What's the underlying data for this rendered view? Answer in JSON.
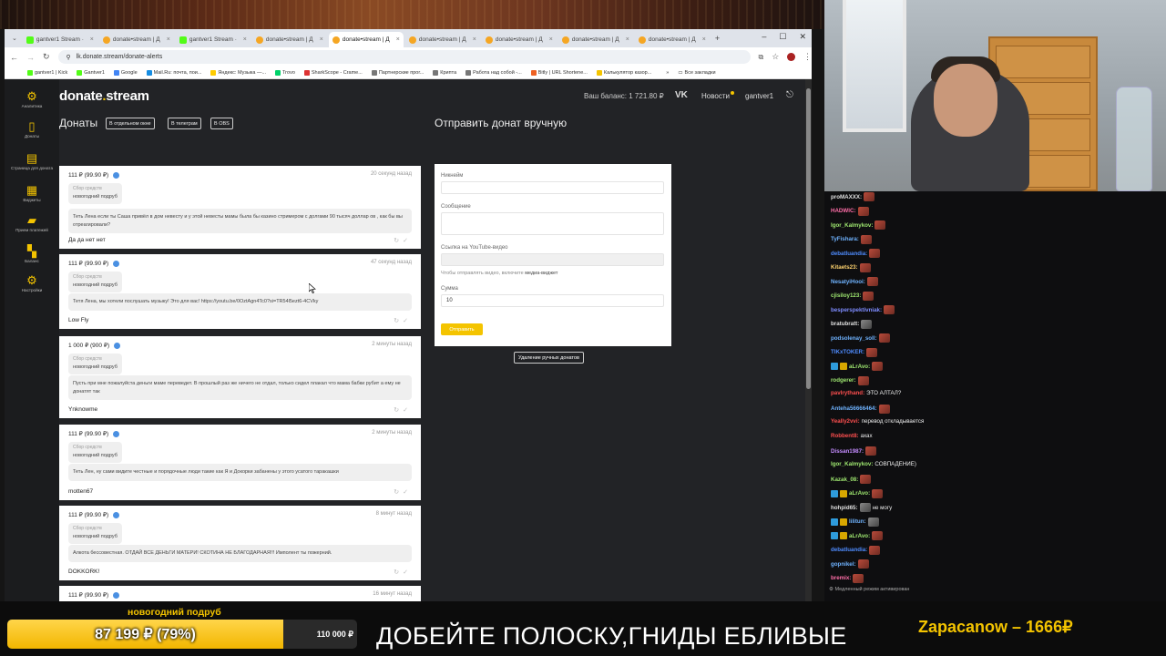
{
  "browser": {
    "tabs": [
      {
        "label": "gantver1 Stream ·",
        "fav": "k"
      },
      {
        "label": "donate•stream | Д",
        "fav": "d"
      },
      {
        "label": "gantver1 Stream ·",
        "fav": "k"
      },
      {
        "label": "donate•stream | Д",
        "fav": "d"
      },
      {
        "label": "donate•stream | Д",
        "fav": "d",
        "active": true
      },
      {
        "label": "donate•stream | Д",
        "fav": "d"
      },
      {
        "label": "donate•stream | Д",
        "fav": "d"
      },
      {
        "label": "donate•stream | Д",
        "fav": "d"
      },
      {
        "label": "donate•stream | Д",
        "fav": "d"
      }
    ],
    "new_tab": "+",
    "url": "lk.donate.stream/donate-alerts",
    "bookmarks": [
      "gantver1 | Kick",
      "Gantver1",
      "Google",
      "Mail.Ru: почта, пои...",
      "Яндекс: Музыка —...",
      "Trovo",
      "SharkScope - Crame...",
      "Партнерские прог...",
      "Крипта",
      "Работа над собой -...",
      "Bitly | URL Shortene...",
      "Калькулятор казор..."
    ],
    "all_bookmarks": "Все закладки"
  },
  "site": {
    "logo_a": "donate",
    "logo_dot": ".",
    "logo_b": "stream",
    "balance": "Ваш баланс: 1 721.80 ₽",
    "vk": "VK",
    "news": "Новости",
    "user": "gantver1",
    "nav": [
      {
        "label": "Аналитика",
        "icon": "chart-icon",
        "glyph": "⚙"
      },
      {
        "label": "Донаты",
        "icon": "phone-icon",
        "glyph": "▯"
      },
      {
        "label": "Страница для доната",
        "icon": "page-icon",
        "glyph": "▤"
      },
      {
        "label": "Виджеты",
        "icon": "widgets-icon",
        "glyph": "▦"
      },
      {
        "label": "Прием платежей",
        "icon": "payments-icon",
        "glyph": "▰"
      },
      {
        "label": "Баланс",
        "icon": "balance-icon",
        "glyph": "▚"
      },
      {
        "label": "Настройки",
        "icon": "settings-icon",
        "glyph": "⚙"
      }
    ],
    "donates_title": "Донаты",
    "pills": [
      "В отдельном окне",
      "В телеграм",
      "В OBS"
    ],
    "manual_title": "Отправить донат вручную"
  },
  "donations": [
    {
      "amount": "111 ₽ (99.90 ₽)",
      "time": "20 секунд назад",
      "goal_label": "Сбор средств",
      "goal": "новогодний подруб",
      "message": "Теть Лена если ты Саша привёл в дом невесту и у этой невесты мамы была бы казино стримером с долгами 90 тысяч доллар ов , как бы вы отреагировали?",
      "sender": "Да да нет нет"
    },
    {
      "amount": "111 ₽ (99.90 ₽)",
      "time": "47 секунд назад",
      "goal_label": "Сбор средств",
      "goal": "новогодний подруб",
      "message": "Тетя Лена, мы хотели послушать музыку! Это для вас! https://youtu.be/0OztAgn4Tc0?si=TR54l5ezt6-4CVky",
      "sender": "Low Fly"
    },
    {
      "amount": "1 000 ₽ (900 ₽)",
      "time": "2 минуты назад",
      "goal_label": "Сбор средств",
      "goal": "новогодний подруб",
      "message": "Пусть при мне пожалуйста деньги маме переведет. В прошлый раз же ничего не отдал, только сидел плакал что мама бабки рубит а ему не донатят так",
      "sender": "Ynknowme"
    },
    {
      "amount": "111 ₽ (99.90 ₽)",
      "time": "2 минуты назад",
      "goal_label": "Сбор средств",
      "goal": "новогодний подруб",
      "message": "Теть Лен, ну сами видите честные и порядочные люди такие как Я и Докорки забанены у этого усатого таракашки",
      "sender": "motten67"
    },
    {
      "amount": "111 ₽ (99.90 ₽)",
      "time": "8 минут назад",
      "goal_label": "Сбор средств",
      "goal": "новогодний подруб",
      "message": "Алкота бессовестная. ОТДАЙ ВСЕ ДЕНЬГИ МАТЕРИ! СКОТИНА НЕ БЛАГОДАРНАЯ!!! Имполент ты пожерний.",
      "sender": "DOKKORK!"
    },
    {
      "amount": "111 ₽ (99.90 ₽)",
      "time": "16 минут назад",
      "goal_label": "Сбор средств",
      "goal": "новогодний подруб",
      "message": "",
      "sender": ""
    }
  ],
  "form": {
    "nickname_label": "Никнейм",
    "message_label": "Сообщение",
    "youtube_label": "Ссылка на YouTube-видео",
    "youtube_hint": "Чтобы отправлять видео, включите",
    "youtube_hint_link": "медиа-виджет",
    "sum_label": "Сумма",
    "sum_value": "10",
    "send_button": "Отправить",
    "delete_button": "Удаление ручных донатов"
  },
  "chat": {
    "lines": [
      {
        "user": "proMAXXX:",
        "color": "#e0e0e0",
        "text": "",
        "emote": true
      },
      {
        "user": "HADWIC:",
        "color": "#ff6ea8",
        "text": "",
        "emote": true
      },
      {
        "user": "Igor_Kalmykov:",
        "color": "#9fe870",
        "text": "",
        "emote": true
      },
      {
        "user": "TyFishara:",
        "color": "#6fb3ff",
        "text": "",
        "emote": true
      },
      {
        "user": "debatluandia:",
        "color": "#4f8cff",
        "text": "",
        "emote": true
      },
      {
        "user": "Kitaets23:",
        "color": "#ffd36e",
        "text": "",
        "emote": true
      },
      {
        "user": "NesatyiHooi:",
        "color": "#6fb3ff",
        "text": "",
        "emote": true
      },
      {
        "user": "cjisiloy123:",
        "color": "#9fe870",
        "text": "",
        "emote": true
      },
      {
        "user": "besperspektivniak:",
        "color": "#7e8cff",
        "text": "",
        "emote": true
      },
      {
        "user": "bratubratt:",
        "color": "#e0e0e0",
        "text": "",
        "emote": true,
        "alt": true
      },
      {
        "user": "podsolenay_soll:",
        "color": "#6fb3ff",
        "text": "",
        "emote": true
      },
      {
        "user": "TIKxTOKER:",
        "color": "#4f8cff",
        "text": "",
        "emote": true
      },
      {
        "user": "aLrAvo:",
        "color": "#9fe870",
        "text": "",
        "emote": true,
        "badges": true
      },
      {
        "user": "rodgerer:",
        "color": "#9fe870",
        "text": "",
        "emote": true
      },
      {
        "user": "pavlrythand:",
        "color": "#ff4f4f",
        "text": "ЭТО АЛТАЛ?",
        "emote": false
      },
      {
        "user": "Anteha56666464:",
        "color": "#6fb3ff",
        "text": "",
        "emote": true
      },
      {
        "user": "Yeally2vvi:",
        "color": "#ff4f4f",
        "text": "перевод откладывается",
        "emote": false
      },
      {
        "user": "Robbent8:",
        "color": "#ff4f4f",
        "text": "ахах",
        "emote": false
      },
      {
        "user": "Dissan1987:",
        "color": "#c48cff",
        "text": "",
        "emote": true
      },
      {
        "user": "Igor_Kalmykov:",
        "color": "#9fe870",
        "text": "СОВПАДЕНИЕ)",
        "emote": false
      },
      {
        "user": "Kazak_08:",
        "color": "#9fe870",
        "text": "",
        "emote": true
      },
      {
        "user": "aLrAvo:",
        "color": "#9fe870",
        "text": "",
        "emote": true,
        "badges": true
      },
      {
        "user": "hohpid65:",
        "color": "#e0e0e0",
        "text": "не могу",
        "emote": true,
        "alt": true
      },
      {
        "user": "lilitun:",
        "color": "#6fb3ff",
        "text": "",
        "emote": true,
        "alt": true,
        "badges": true
      },
      {
        "user": "aLrAvo:",
        "color": "#9fe870",
        "text": "",
        "emote": true,
        "badges": true
      },
      {
        "user": "debatluandia:",
        "color": "#4f8cff",
        "text": "",
        "emote": true
      },
      {
        "user": "gopnikel:",
        "color": "#6fb3ff",
        "text": "",
        "emote": true
      },
      {
        "user": "bremix:",
        "color": "#ff6ea8",
        "text": "",
        "emote": true
      }
    ],
    "footer": "Медленный режим активирован"
  },
  "overlay": {
    "goal_title": "новогодний подруб",
    "progress_text": "87 199 ₽ (79%)",
    "progress_fraction": 0.79,
    "goal_target": "110 000 ₽",
    "caption": "ДОБЕЙТЕ ПОЛОСКУ,ГНИДЫ ЕБЛИВЫЕ",
    "top_donor": "Zapacanow – 1666₽"
  },
  "colors": {
    "accent": "#f4c400",
    "link": "#4a90e2"
  }
}
